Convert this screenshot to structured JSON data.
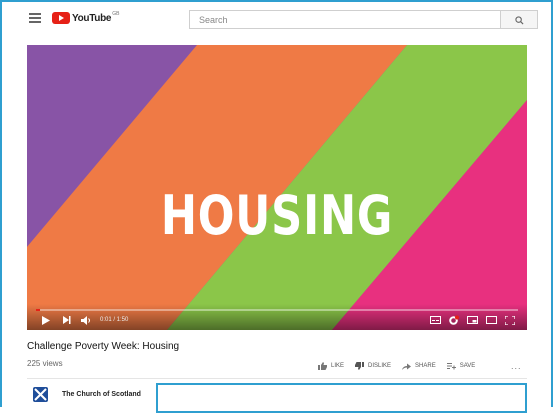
{
  "header": {
    "logo_text": "YouTube",
    "logo_region": "GB",
    "search_placeholder": "Search"
  },
  "player": {
    "title_card": "HOUSING",
    "time": "0:01 / 1:50",
    "progress": 0.009,
    "colors": {
      "purple": "#8854a6",
      "orange": "#ef7a45",
      "green": "#8bc649",
      "pink": "#e8307f",
      "progress_red": "#e62117"
    }
  },
  "video": {
    "title": "Challenge Poverty Week: Housing",
    "views": "225 views"
  },
  "actions": {
    "like": "LIKE",
    "dislike": "DISLIKE",
    "share": "SHARE",
    "save": "SAVE",
    "more": "..."
  },
  "channel": {
    "name": "The Church of Scotland"
  },
  "accent_color": "#2f9fd0"
}
